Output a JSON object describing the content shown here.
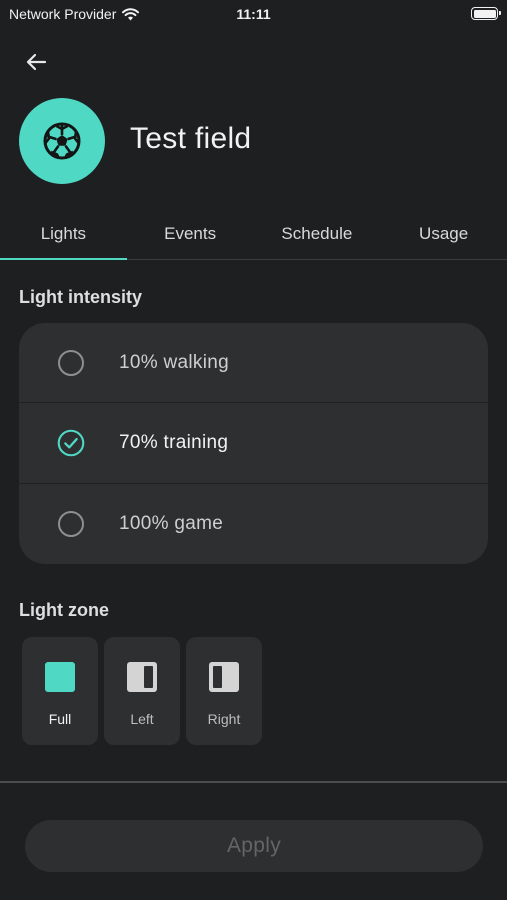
{
  "status_bar": {
    "carrier": "Network Provider",
    "time": "11:11"
  },
  "header": {
    "title": "Test field",
    "avatar_icon": "soccer-ball-icon",
    "back_icon": "arrow-left-icon"
  },
  "tabs": [
    {
      "label": "Lights",
      "active": true
    },
    {
      "label": "Events",
      "active": false
    },
    {
      "label": "Schedule",
      "active": false
    },
    {
      "label": "Usage",
      "active": false
    }
  ],
  "light_intensity": {
    "title": "Light intensity",
    "options": [
      {
        "label": "10% walking",
        "selected": false
      },
      {
        "label": "70% training",
        "selected": true
      },
      {
        "label": "100% game",
        "selected": false
      }
    ]
  },
  "light_zone": {
    "title": "Light zone",
    "options": [
      {
        "label": "Full",
        "selected": true,
        "icon": "zone-full-icon"
      },
      {
        "label": "Left",
        "selected": false,
        "icon": "zone-left-icon"
      },
      {
        "label": "Right",
        "selected": false,
        "icon": "zone-right-icon"
      }
    ]
  },
  "footer": {
    "apply_label": "Apply",
    "apply_enabled": false
  },
  "colors": {
    "accent": "#4fd8c4",
    "background": "#1e1f20",
    "card": "#2d2f30"
  }
}
